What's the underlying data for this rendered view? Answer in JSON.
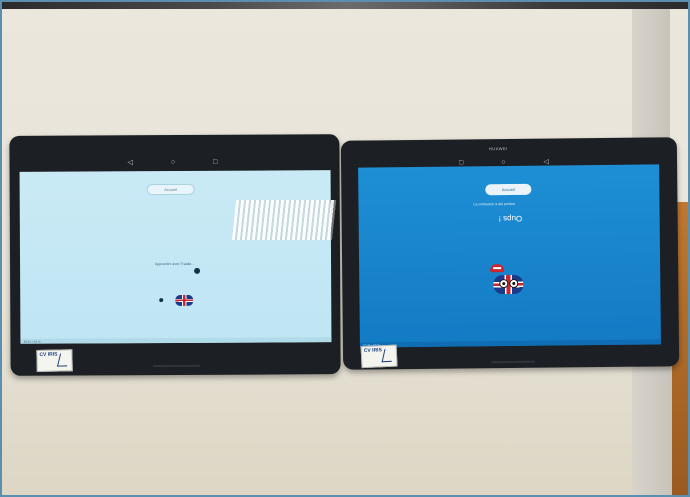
{
  "photo": {
    "left_tablet": {
      "nav_glyphs": [
        "◁",
        "○",
        "□"
      ],
      "button_label": "Accueil",
      "message": "Apprendre avec Tralala...",
      "status_text": "10:44  ▪ 54 %",
      "sticker_text": "CV IRIS"
    },
    "right_tablet": {
      "brand": "HUAWEI",
      "nav_glyphs": [
        "□",
        "○",
        "◁"
      ],
      "button_label": "Accueil",
      "oups": "Oups !",
      "message": "La connexion a été perdue",
      "status_text": "10:44  ▪ 53 %",
      "sticker_text": "CV IRIS"
    }
  }
}
